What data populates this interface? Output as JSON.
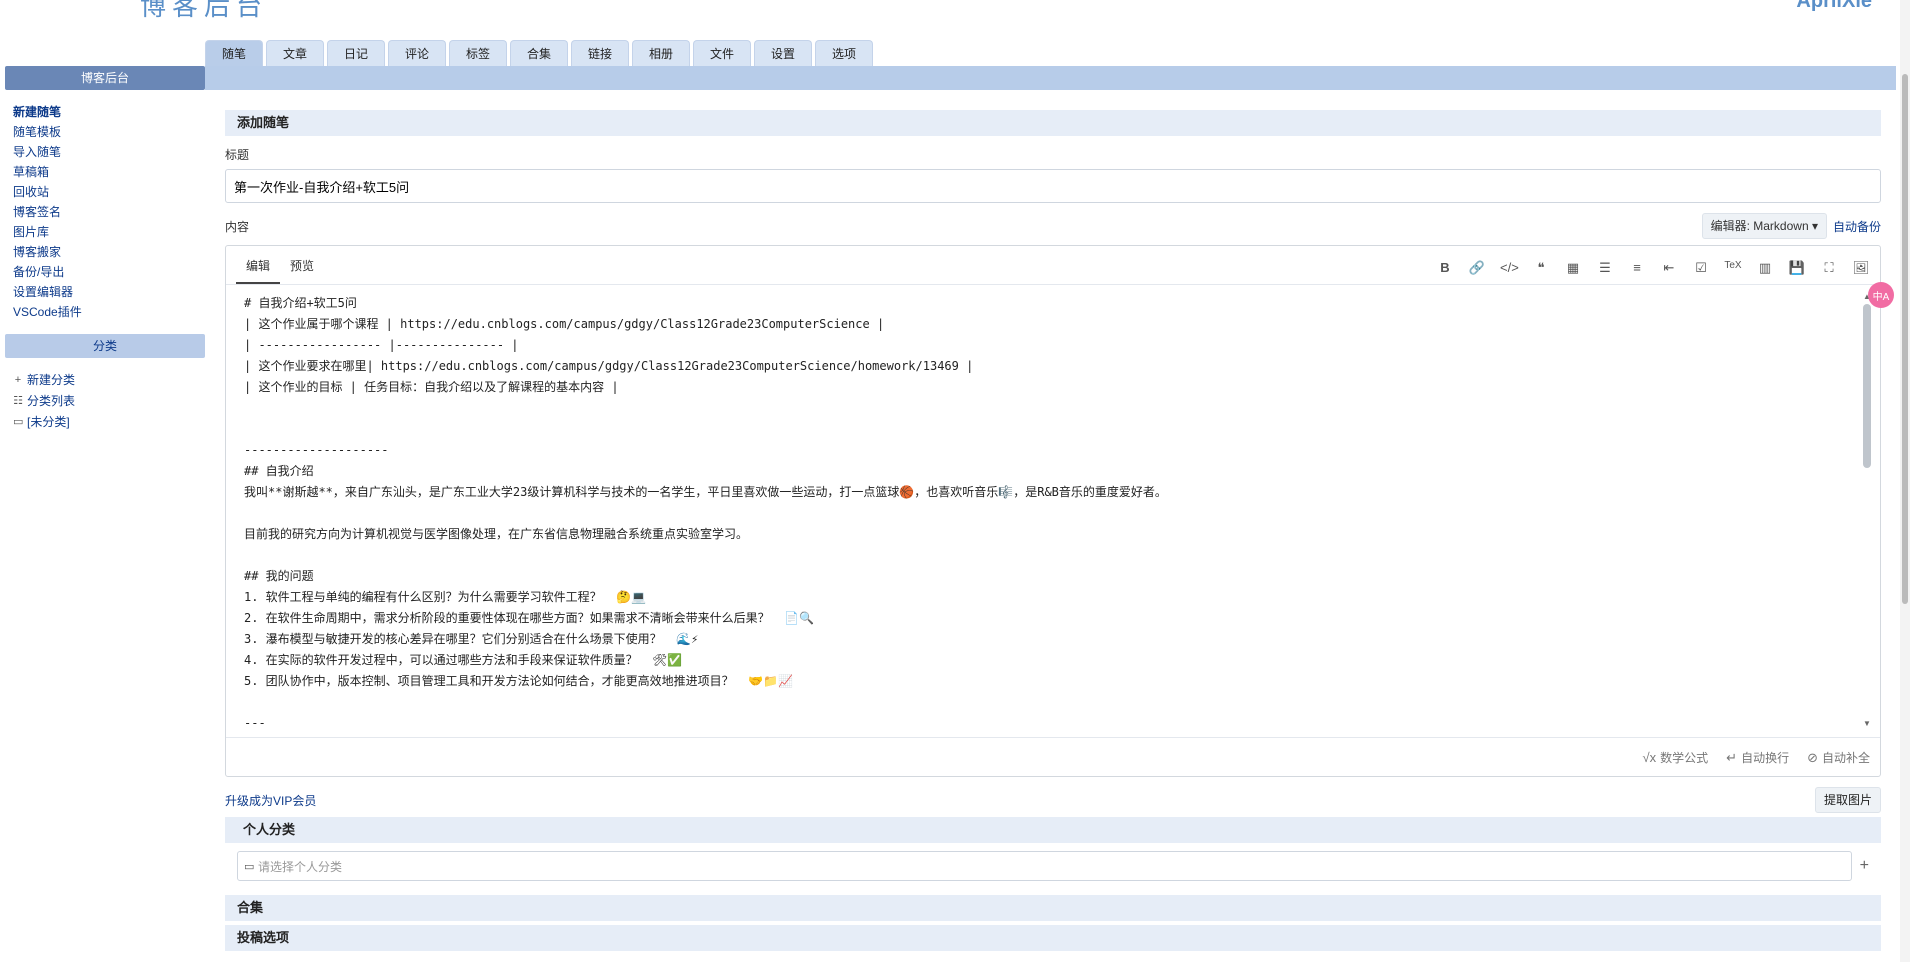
{
  "header": {
    "logo": "博客后台",
    "right": "AprilXie"
  },
  "tabs": [
    "随笔",
    "文章",
    "日记",
    "评论",
    "标签",
    "合集",
    "链接",
    "相册",
    "文件",
    "设置",
    "选项"
  ],
  "sidebar": {
    "title": "博客后台",
    "items": [
      "新建随笔",
      "随笔模板",
      "导入随笔",
      "草稿箱",
      "回收站",
      "博客签名",
      "图片库",
      "博客搬家",
      "备份/导出",
      "设置编辑器",
      "VSCode插件"
    ],
    "category_title": "分类",
    "category_items": [
      {
        "icon": "+",
        "label": "新建分类"
      },
      {
        "icon": "☷",
        "label": "分类列表"
      },
      {
        "icon": "▭",
        "label": "[未分类]"
      }
    ]
  },
  "main": {
    "section_title": "添加随笔",
    "title_label": "标题",
    "title_value": "第一次作业-自我介绍+软工5问",
    "content_label": "内容",
    "editor_label": "编辑器: Markdown ▾",
    "autosave": "自动备份",
    "editor_tabs": [
      "编辑",
      "预览"
    ],
    "toolbar": [
      "B",
      "🔗",
      "</>",
      "❝",
      "▦",
      "☰",
      "≡",
      "⇤",
      "☑",
      "TeX",
      "▥",
      "💾",
      "⛶",
      "🖼"
    ],
    "content": "# 自我介绍+软工5问\n| 这个作业属于哪个课程 | https://edu.cnblogs.com/campus/gdgy/Class12Grade23ComputerScience |\n| ----------------- |--------------- |\n| 这个作业要求在哪里| https://edu.cnblogs.com/campus/gdgy/Class12Grade23ComputerScience/homework/13469 |\n| 这个作业的目标 | 任务目标：自我介绍以及了解课程的基本内容 |\n\n\n--------------------\n## 自我介绍\n我叫**谢斯越**，来自广东汕头，是广东工业大学23级计算机科学与技术的一名学生，平日里喜欢做一些运动，打一点篮球🏀，也喜欢听音乐🎼，是R&B音乐的重度爱好者。\n\n目前我的研究方向为计算机视觉与医学图像处理，在广东省信息物理融合系统重点实验室学习。\n\n## 我的问题\n1. 软件工程与单纯的编程有什么区别？为什么需要学习软件工程？  🤔💻\n2. 在软件生命周期中，需求分析阶段的重要性体现在哪些方面？如果需求不清晰会带来什么后果？  📄🔍\n3. 瀑布模型与敏捷开发的核心差异在哪里？它们分别适合在什么场景下使用？  🌊⚡\n4. 在实际的软件开发过程中，可以通过哪些方法和手段来保证软件质量？  🛠✅\n5. 团队协作中，版本控制、项目管理工具和开发方法论如何结合，才能更高效地推进项目？  🤝📁📈\n\n---",
    "bottom_tools": [
      {
        "icon": "√x",
        "label": "数学公式"
      },
      {
        "icon": "↵",
        "label": "自动换行"
      },
      {
        "icon": "⊘",
        "label": "自动补全"
      }
    ],
    "vip_link": "升级成为VIP会员",
    "extract_button": "提取图片",
    "personal_category_title": "个人分类",
    "personal_category_placeholder": "请选择个人分类",
    "collection_title": "合集",
    "submit_options_title": "投稿选项"
  },
  "fab_label": "中A"
}
